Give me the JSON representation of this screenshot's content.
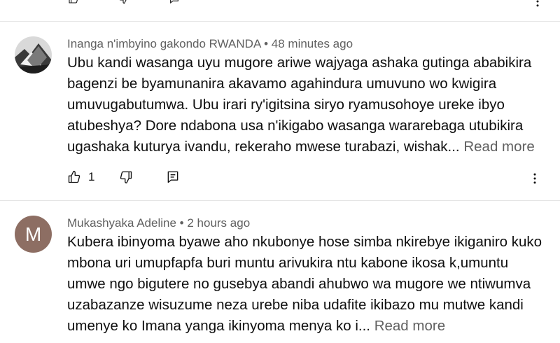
{
  "comments": [
    {
      "author": "Inanga n'imbyino gakondo RWANDA",
      "separator": "•",
      "time": "48 minutes ago",
      "text": "Ubu kandi wasanga uyu mugore ariwe wajyaga ashaka gutinga ababikira bagenzi be byamunanira akavamo agahindura umuvuno wo kwigira umuvugabutumwa. Ubu irari ry'igitsina siryo ryamusohoye ureke ibyo atubeshya? Dore ndabona usa n'ikigabo wasanga wararebaga utubikira ugashaka kuturya ivandu, rekeraho mwese turabazi, wishak...",
      "read_more": "Read more",
      "likes": "1",
      "avatar_icon": "photo-avatar"
    },
    {
      "author": "Mukashyaka Adeline",
      "separator": "•",
      "time": "2 hours ago",
      "text": "Kubera ibinyoma byawe aho nkubonye hose simba nkirebye ikiganiro kuko mbona uri umupfapfa buri muntu arivukira ntu kabone ikosa k,umuntu umwe ngo bigutere no gusebya abandi ahubwo wa mugore we ntiwumva uzabazanze wisuzume neza urebe niba udafite ikibazo mu mutwe kandi umenye ko Imana yanga ikinyoma menya ko i...",
      "read_more": "Read more",
      "avatar_letter": "M",
      "avatar_color": "#8d6e63"
    }
  ],
  "icons": {
    "like": "thumb-up-icon",
    "dislike": "thumb-down-icon",
    "reply": "reply-icon",
    "more": "more-vertical-icon"
  }
}
